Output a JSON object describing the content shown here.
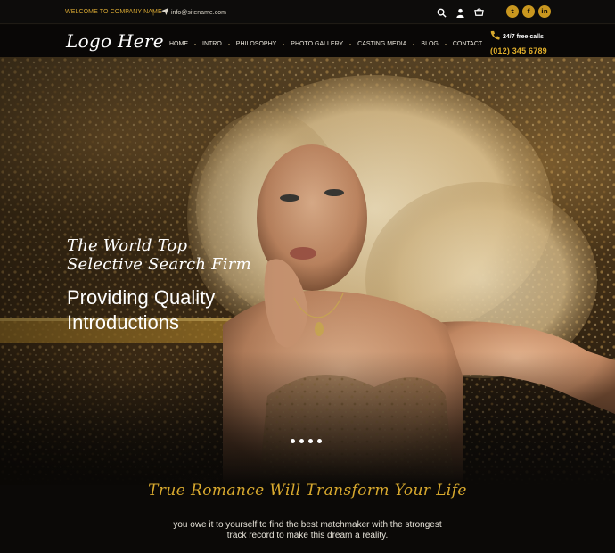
{
  "topbar": {
    "welcome": "WELCOME TO COMPANY NAME",
    "separator": "|",
    "email": "info@sitename.com",
    "icons": [
      "search-icon",
      "user-icon",
      "cart-icon"
    ],
    "socials": [
      {
        "name": "twitter-icon",
        "glyph": "t"
      },
      {
        "name": "facebook-icon",
        "glyph": "f"
      },
      {
        "name": "linkedin-icon",
        "glyph": "in"
      }
    ]
  },
  "header": {
    "logo": "Logo Here",
    "nav": [
      "HOME",
      "INTRO",
      "PHILOSOPHY",
      "PHOTO GALLERY",
      "CASTING MEDIA",
      "BLOG",
      "CONTACT"
    ],
    "calls_label": "24/7 free calls",
    "calls_phone": "(012) 345 6789"
  },
  "hero": {
    "tagline_script_line1": "The World Top",
    "tagline_script_line2": "Selective Search Firm",
    "tagline_line1": "Providing Quality",
    "tagline_line2": "Introductions",
    "slides": 4,
    "active_slide": 1
  },
  "intro": {
    "title": "True Romance Will Transform Your Life",
    "text_line1": "you owe it to yourself to find the best matchmaker with the strongest",
    "text_line2": "track record to make this dream a reality."
  },
  "colors": {
    "accent": "#d8a92e",
    "background": "#0b0907"
  }
}
